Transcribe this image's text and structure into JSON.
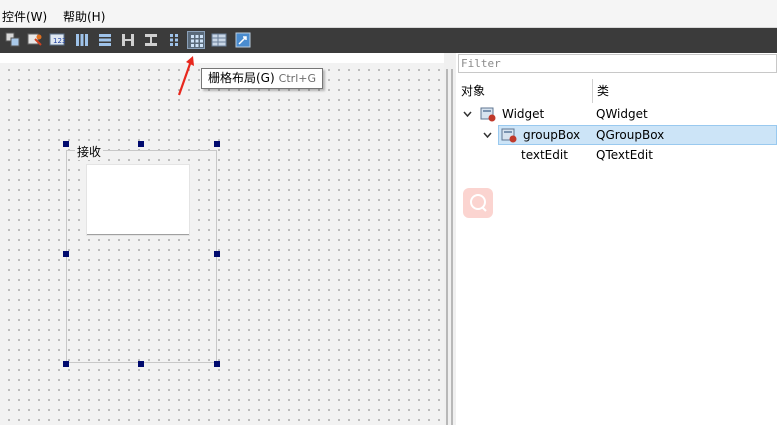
{
  "menubar": {
    "items": [
      {
        "label": "控件(W)",
        "x": 2
      },
      {
        "label": "帮助(H)",
        "x": 63
      }
    ]
  },
  "toolbar": {
    "buttons": [
      {
        "name": "send-to-back-icon",
        "active": false
      },
      {
        "name": "edit-buddies-icon",
        "active": false
      },
      {
        "name": "edit-tab-order-icon",
        "active": false
      },
      {
        "name": "layout-horizontal-icon",
        "active": false
      },
      {
        "name": "layout-vertical-icon",
        "active": false
      },
      {
        "name": "layout-horizontal-splitter-icon",
        "active": false
      },
      {
        "name": "layout-vertical-splitter-icon",
        "active": false
      },
      {
        "name": "layout-form-icon",
        "active": false
      },
      {
        "name": "layout-grid-icon",
        "active": true
      },
      {
        "name": "break-layout-icon",
        "active": false
      },
      {
        "name": "adjust-size-icon",
        "active": false
      }
    ]
  },
  "tooltip": {
    "text": "栅格布局(G)",
    "shortcut": "Ctrl+G"
  },
  "form": {
    "groupbox_title": "接收"
  },
  "inspector": {
    "filter_placeholder": "Filter",
    "col_object": "对象",
    "col_class": "类",
    "rows": [
      {
        "object": "Widget",
        "class": "QWidget"
      },
      {
        "object": "groupBox",
        "class": "QGroupBox"
      },
      {
        "object": "textEdit",
        "class": "QTextEdit"
      }
    ]
  },
  "colors": {
    "selection": "#cce4f7",
    "toolbar_bg": "#3b3b3b",
    "handle": "#000a6e"
  }
}
